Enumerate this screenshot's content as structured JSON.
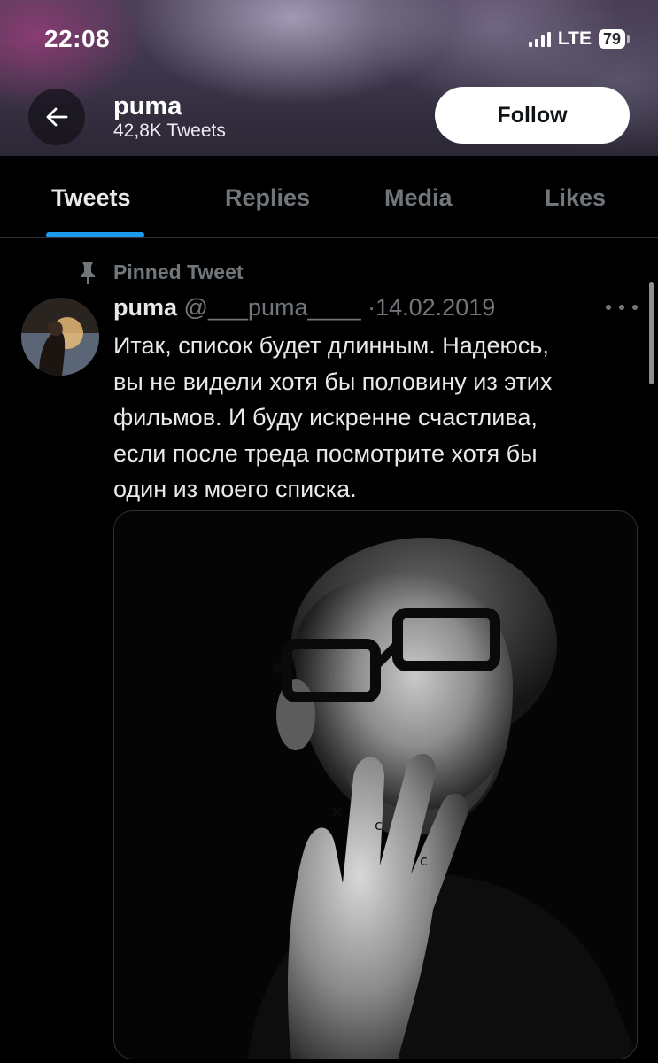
{
  "status_bar": {
    "time": "22:08",
    "network": "LTE",
    "battery": "79"
  },
  "header": {
    "name": "puma",
    "tweet_count": "42,8K Tweets",
    "follow_label": "Follow"
  },
  "tabs": [
    {
      "label": "Tweets",
      "active": true
    },
    {
      "label": "Replies",
      "active": false
    },
    {
      "label": "Media",
      "active": false
    },
    {
      "label": "Likes",
      "active": false
    }
  ],
  "tweet": {
    "pinned_label": "Pinned Tweet",
    "author_name": "puma",
    "handle": "@___puma____",
    "separator": "·",
    "date": "14.02.2019",
    "text_lines": [
      "Итак, список будет длинным. Надеюсь,",
      "вы не видели хотя бы половину из этих",
      "фильмов. И буду искренне счастлива,",
      "если после треда посмотрите хотя бы",
      "один из моего списка."
    ],
    "media": "black-and-white portrait photo"
  },
  "colors": {
    "accent": "#1d9bf0",
    "background": "#000000",
    "muted": "#71767b",
    "text": "#e7e9ea"
  },
  "icons": [
    "back-arrow-icon",
    "pin-icon",
    "more-icon",
    "signal-icon",
    "battery-icon"
  ]
}
